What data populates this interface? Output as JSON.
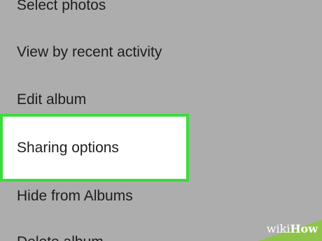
{
  "menu": {
    "items": [
      {
        "label": "Select photos"
      },
      {
        "label": "View by recent activity"
      },
      {
        "label": "Edit album"
      },
      {
        "label": "Sharing options",
        "highlighted": true
      },
      {
        "label": "Hide from Albums"
      },
      {
        "label": "Delete album"
      }
    ]
  },
  "watermark": {
    "wiki": "wiki",
    "how": "How"
  },
  "colors": {
    "background": "#adadad",
    "highlight_fill": "#ffffff",
    "highlight_border": "#3cdb3c",
    "watermark_green": "#8cc63f"
  }
}
